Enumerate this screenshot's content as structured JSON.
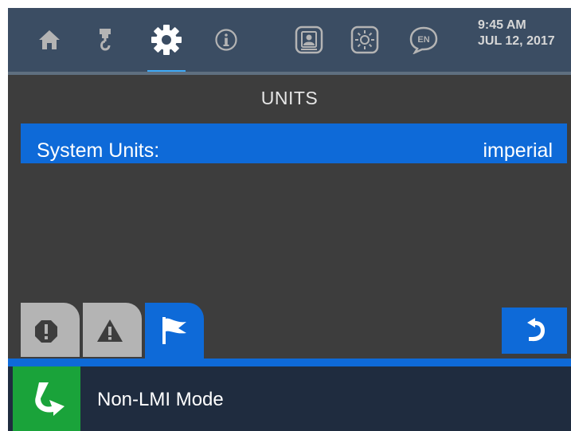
{
  "nav": {
    "items": [
      {
        "name": "home",
        "icon": "home-icon"
      },
      {
        "name": "crane-hook",
        "icon": "crane-hook-icon"
      },
      {
        "name": "settings",
        "icon": "gear-icon",
        "active": true
      },
      {
        "name": "info",
        "icon": "info-icon"
      },
      {
        "name": "operator",
        "icon": "operator-id-icon"
      },
      {
        "name": "brightness",
        "icon": "brightness-icon"
      },
      {
        "name": "language",
        "icon": "language-icon",
        "label": "EN"
      }
    ],
    "active_color": "#3fa9f5"
  },
  "clock": {
    "time": "9:45 AM",
    "date": "JUL 12, 2017"
  },
  "page": {
    "title": "UNITS"
  },
  "settings": [
    {
      "label": "System Units:",
      "value": "imperial",
      "selected": true
    }
  ],
  "tabs": [
    {
      "name": "alarms",
      "icon": "alarm-octagon-icon",
      "active": false
    },
    {
      "name": "warnings",
      "icon": "warning-triangle-icon",
      "active": false
    },
    {
      "name": "notices",
      "icon": "flag-icon",
      "active": true
    }
  ],
  "back_button": {
    "icon": "back-arrow-icon"
  },
  "status": {
    "mode_icon": "mode-arrow-icon",
    "mode_label": "Non-LMI Mode",
    "mode_color": "#1aa33a"
  },
  "colors": {
    "topbar": "#3b4d63",
    "background": "#3d3d3d",
    "accent_blue": "#0e6ad8",
    "status_bar": "#1f2c3f",
    "icon": "#b4b4b4"
  }
}
